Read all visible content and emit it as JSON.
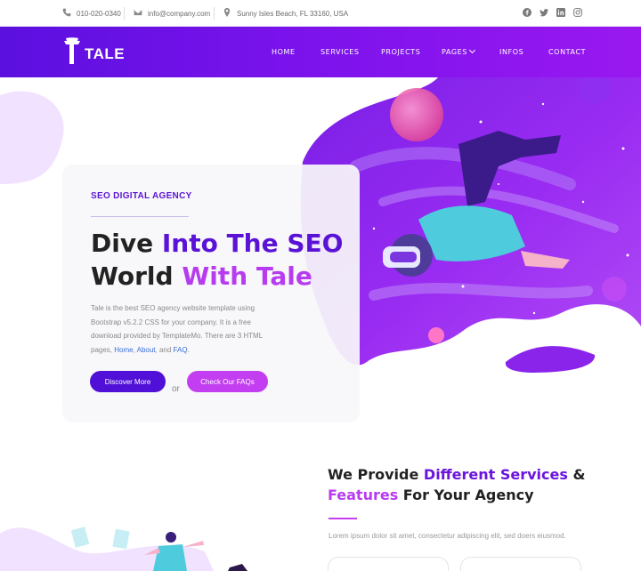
{
  "topbar": {
    "phone": "010-020-0340",
    "email": "info@company.com",
    "address": "Sunny Isles Beach, FL 33160, USA",
    "social_icons": [
      "facebook-icon",
      "twitter-icon",
      "linkedin-icon",
      "instagram-icon"
    ]
  },
  "brand": {
    "name": "TALE"
  },
  "nav": {
    "items": [
      "HOME",
      "SERVICES",
      "PROJECTS",
      "PAGES",
      "INFOS",
      "CONTACT"
    ]
  },
  "hero": {
    "tag": "SEO DIGITAL AGENCY",
    "title_plain1": "Dive ",
    "title_purple1": "Into The SEO",
    "title_plain2": "World ",
    "title_purple2": "With Tale",
    "desc_text": "Tale is the best SEO agency website template using Bootstrap v5.2.2 CSS for your company. It is a free download provided by TemplateMo. There are 3 HTML pages, ",
    "link_home": "Home",
    "comma": ",",
    "link_about": "About",
    "and": ", and",
    "link_faq": "FAQ",
    "period": ".",
    "btn_discover": "Discover More",
    "or": "or",
    "btn_faq": "Check Our FAQs"
  },
  "services": {
    "title_a": "We Provide ",
    "title_b": "Different Services",
    "title_c": " &",
    "title_d": "Features",
    "title_e": " For Your Agency",
    "lead": "Lorem ipsum dolor sit amet, consectetur adipiscing elit, sed doers eiusmod."
  },
  "colors": {
    "primary": "#5110d8",
    "accent": "#c23ef0",
    "header_gradient_start": "#5b10e0",
    "header_gradient_end": "#9a18f0"
  }
}
